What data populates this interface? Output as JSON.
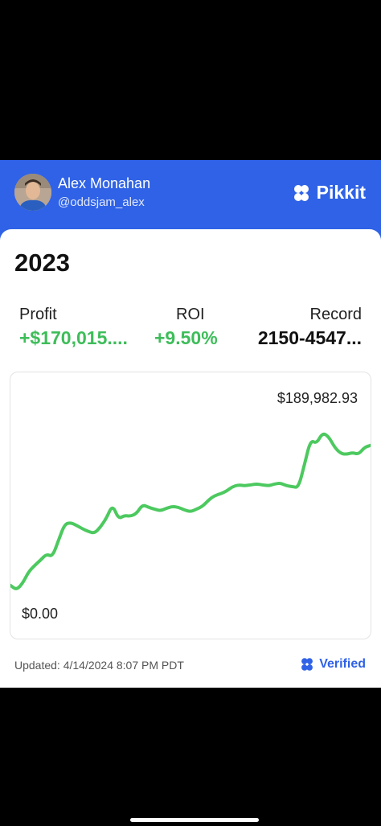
{
  "profile": {
    "name": "Alex Monahan",
    "handle": "@oddsjam_alex"
  },
  "brand": {
    "name": "Pikkit",
    "icon": "clover-icon"
  },
  "card": {
    "year": "2023",
    "stats": {
      "profit_label": "Profit",
      "profit_value": "+$170,015....",
      "roi_label": "ROI",
      "roi_value": "+9.50%",
      "record_label": "Record",
      "record_value": "2150-4547..."
    },
    "chart_max_label": "$189,982.93",
    "chart_min_label": "$0.00",
    "updated": "Updated: 4/14/2024 8:07 PM PDT",
    "verified_label": "Verified"
  },
  "colors": {
    "header_blue": "#2f62e6",
    "profit_green": "#3ebd5a",
    "line_green": "#4cc95f"
  },
  "chart_data": {
    "type": "line",
    "ylim": [
      0,
      189982.93
    ],
    "series": [
      {
        "values": [
          10000,
          5000,
          12000,
          25000,
          32000,
          38000,
          45000,
          42000,
          60000,
          78000,
          80000,
          77000,
          73000,
          70000,
          68000,
          75000,
          85000,
          100000,
          84000,
          88000,
          87000,
          90000,
          100000,
          97000,
          95000,
          93000,
          96000,
          98000,
          97000,
          94000,
          92000,
          95000,
          98000,
          105000,
          110000,
          112000,
          115000,
          120000,
          122000,
          121000,
          122000,
          123000,
          122000,
          121000,
          123000,
          124000,
          121000,
          120000,
          119000,
          145000,
          172000,
          168000,
          180000,
          176000,
          164000,
          157000,
          156000,
          158000,
          156000,
          164000,
          166000
        ]
      }
    ]
  }
}
